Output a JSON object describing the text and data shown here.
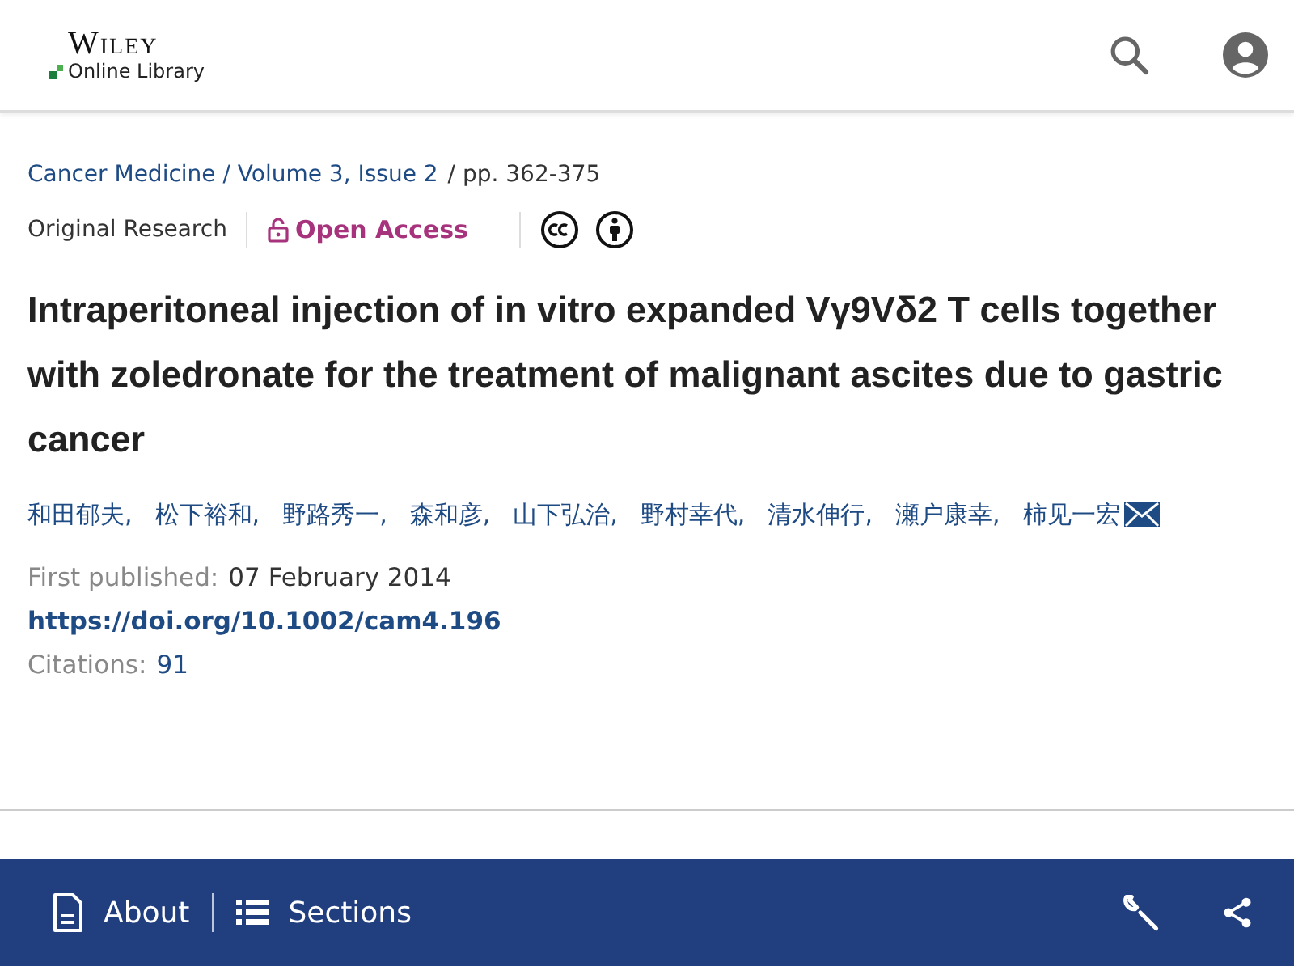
{
  "header": {
    "logo_word": "Wiley",
    "logo_sub": "Online Library"
  },
  "breadcrumb": {
    "link": "Cancer Medicine / Volume 3, Issue 2",
    "pages": "/  pp. 362-375"
  },
  "tags": {
    "type": "Original Research",
    "access": "Open Access"
  },
  "title": "Intraperitoneal injection of in vitro expanded Vγ9Vδ2 T cells together with zoledronate for the treatment of malignant ascites due to gastric cancer",
  "authors": [
    {
      "name": "和田郁夫,",
      "email": false
    },
    {
      "name": "松下裕和,",
      "email": false
    },
    {
      "name": "野路秀一,",
      "email": false
    },
    {
      "name": "森和彦,",
      "email": false
    },
    {
      "name": "山下弘治,",
      "email": false
    },
    {
      "name": "野村幸代,",
      "email": false
    },
    {
      "name": "清水伸行,",
      "email": false
    },
    {
      "name": "瀬户康幸,",
      "email": false
    },
    {
      "name": "柿见一宏",
      "email": true
    }
  ],
  "published": {
    "label": "First published:",
    "date": "07 February 2014"
  },
  "doi": "https://doi.org/10.1002/cam4.196",
  "citations": {
    "label": "Citations:",
    "count": "91"
  },
  "bottom_bar": {
    "about": "About",
    "sections": "Sections"
  }
}
